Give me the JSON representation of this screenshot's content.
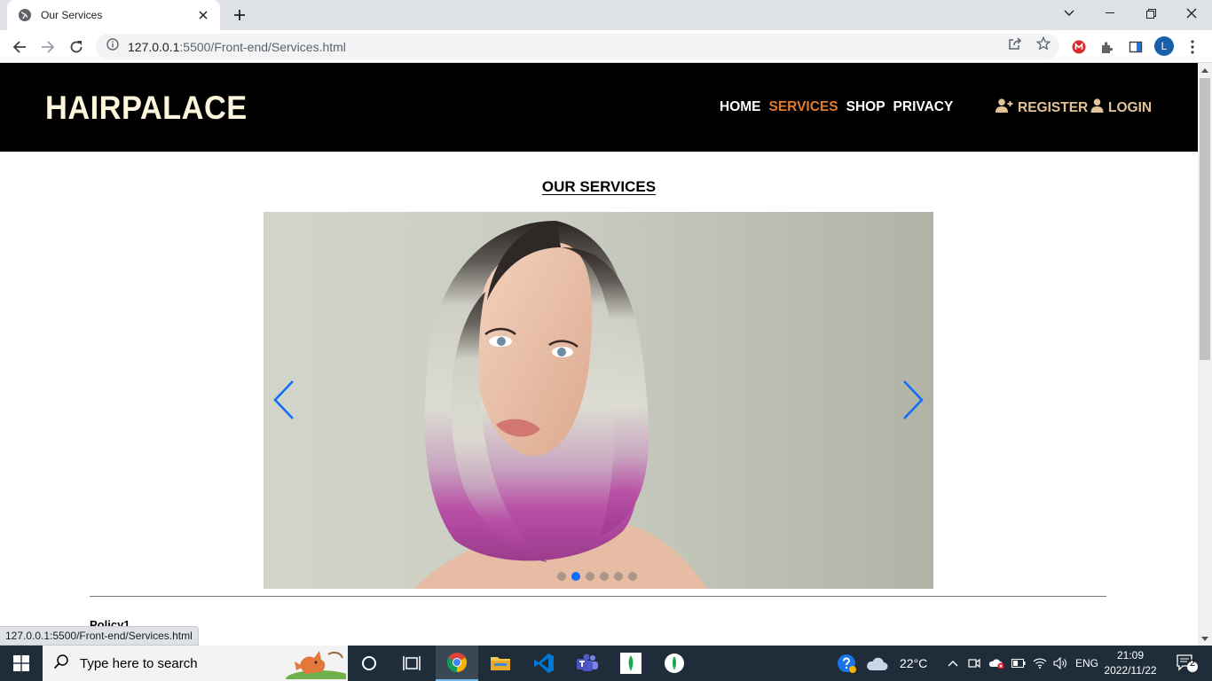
{
  "browser": {
    "tab_title": "Our Services",
    "url_host": "127.0.0.1",
    "url_rest": ":5500/Front-end/Services.html",
    "profile_initial": "L",
    "status_url": "127.0.0.1:5500/Front-end/Services.html"
  },
  "site": {
    "logo": "HAIRPALACE",
    "nav": [
      "HOME",
      "SERVICES",
      "SHOP",
      "PRIVACY"
    ],
    "active_nav": "SERVICES",
    "register": "REGISTER",
    "login": "LOGIN",
    "accent_color": "#e07a2b",
    "auth_color": "#e2c397",
    "header_bg": "#000000"
  },
  "main": {
    "title": "OUR SERVICES",
    "carousel": {
      "slide_count": 6,
      "active_index": 1
    },
    "policy_heading": "Policy1"
  },
  "taskbar": {
    "search_placeholder": "Type here to search",
    "weather": "22°C",
    "language": "ENG",
    "time": "21:09",
    "date": "2022/11/22",
    "notification_count": "2"
  }
}
